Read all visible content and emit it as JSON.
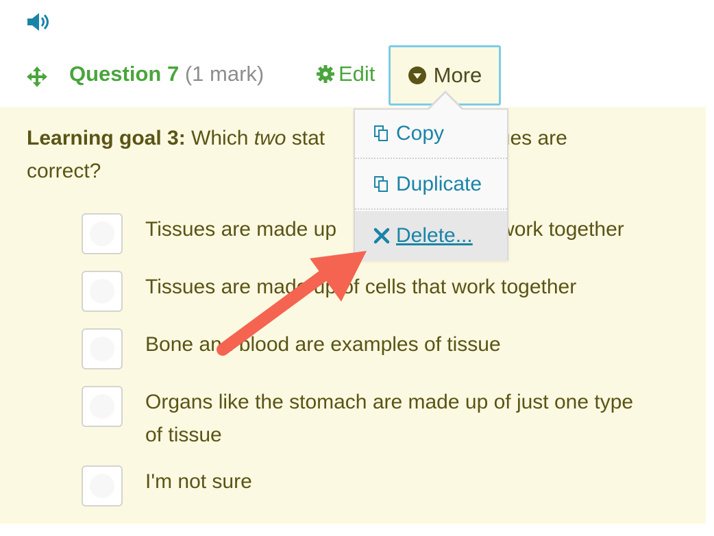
{
  "toolbar": {
    "question_title": "Question 7",
    "question_marks": "(1 mark)",
    "edit_label": "Edit",
    "more_label": "More"
  },
  "question": {
    "goal_label": "Learning goal 3:",
    "text_before": " Which ",
    "text_emphasis": "two",
    "text_after_visible_left": " stat",
    "text_after_visible_right": "issues are",
    "text_line2": "correct?"
  },
  "options": [
    {
      "label_left": "Tissues are made up",
      "label_right": "work together"
    },
    {
      "label": "Tissues are made up of cells that work together"
    },
    {
      "label": "Bone and blood are examples of tissue"
    },
    {
      "label": "Organs like the stomach are made up of just one type of tissue"
    },
    {
      "label": "I'm not sure"
    }
  ],
  "menu": {
    "items": [
      {
        "label": "Copy",
        "icon": "copy-icon"
      },
      {
        "label": "Duplicate",
        "icon": "copy-icon"
      },
      {
        "label": "Delete...",
        "icon": "close-icon"
      }
    ]
  },
  "colors": {
    "accent_green": "#4aa53c",
    "link_blue": "#1a84a8",
    "panel_bg": "#fcf9e2",
    "arrow": "#f46450"
  }
}
